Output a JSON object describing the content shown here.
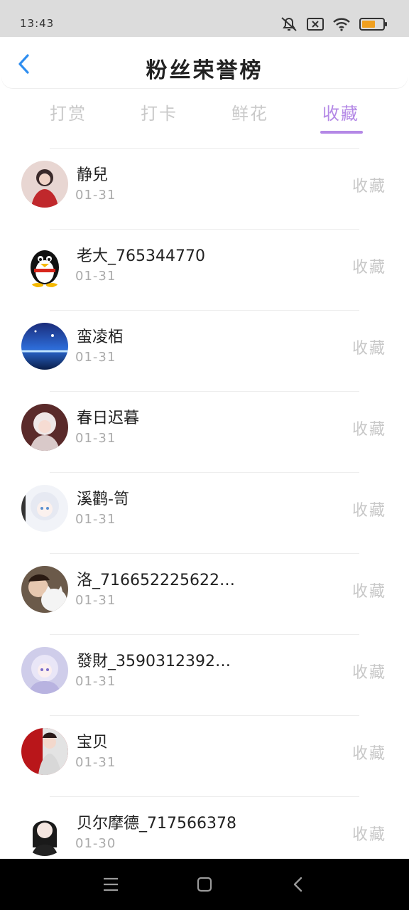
{
  "status_bar": {
    "time": "13:43"
  },
  "header": {
    "title": "粉丝荣誉榜"
  },
  "tabs": [
    {
      "label": "打赏",
      "active": false
    },
    {
      "label": "打卡",
      "active": false
    },
    {
      "label": "鲜花",
      "active": false
    },
    {
      "label": "收藏",
      "active": true
    }
  ],
  "list": [
    {
      "name": "静兒",
      "date": "01-31",
      "action": "收藏",
      "avatar": "avatar-photo"
    },
    {
      "name": "老大_765344770",
      "date": "01-31",
      "action": "收藏",
      "avatar": "qq-penguin"
    },
    {
      "name": "蛮凌栢",
      "date": "01-31",
      "action": "收藏",
      "avatar": "avatar-photo"
    },
    {
      "name": "春日迟暮",
      "date": "01-31",
      "action": "收藏",
      "avatar": "avatar-photo"
    },
    {
      "name": "溪鹳-笥",
      "date": "01-31",
      "action": "收藏",
      "avatar": "avatar-photo"
    },
    {
      "name": "洛_7166522256224…",
      "date": "01-31",
      "action": "收藏",
      "avatar": "avatar-photo"
    },
    {
      "name": "發財_35903123923…",
      "date": "01-31",
      "action": "收藏",
      "avatar": "avatar-photo"
    },
    {
      "name": "宝贝",
      "date": "01-31",
      "action": "收藏",
      "avatar": "avatar-photo"
    },
    {
      "name": "贝尔摩德_717566378",
      "date": "01-30",
      "action": "收藏",
      "avatar": "avatar-photo"
    }
  ],
  "colors": {
    "accent": "#b488e6",
    "back": "#2f8ef0"
  }
}
